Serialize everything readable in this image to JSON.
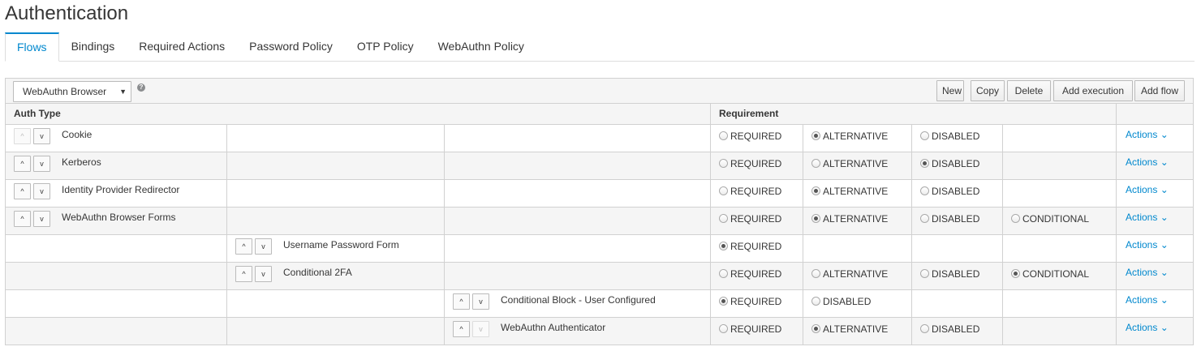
{
  "page": {
    "title": "Authentication"
  },
  "tabs": [
    {
      "label": "Flows",
      "active": true
    },
    {
      "label": "Bindings"
    },
    {
      "label": "Required Actions"
    },
    {
      "label": "Password Policy"
    },
    {
      "label": "OTP Policy"
    },
    {
      "label": "WebAuthn Policy"
    }
  ],
  "toolbar": {
    "flow_select": "WebAuthn Browser",
    "help_icon": "?",
    "buttons": {
      "new": "New",
      "copy": "Copy",
      "delete": "Delete",
      "add_execution": "Add execution",
      "add_flow": "Add flow"
    }
  },
  "table": {
    "headers": {
      "auth_type": "Auth Type",
      "requirement": "Requirement"
    },
    "rows": [
      {
        "level": 0,
        "name": "Cookie",
        "up_disabled": true,
        "down_disabled": false,
        "options": [
          {
            "label": "REQUIRED",
            "checked": false
          },
          {
            "label": "ALTERNATIVE",
            "checked": true
          },
          {
            "label": "DISABLED",
            "checked": false
          }
        ],
        "actions": "Actions"
      },
      {
        "level": 0,
        "name": "Kerberos",
        "up_disabled": false,
        "down_disabled": false,
        "options": [
          {
            "label": "REQUIRED",
            "checked": false
          },
          {
            "label": "ALTERNATIVE",
            "checked": false
          },
          {
            "label": "DISABLED",
            "checked": true
          }
        ],
        "actions": "Actions"
      },
      {
        "level": 0,
        "name": "Identity Provider Redirector",
        "up_disabled": false,
        "down_disabled": false,
        "options": [
          {
            "label": "REQUIRED",
            "checked": false
          },
          {
            "label": "ALTERNATIVE",
            "checked": true
          },
          {
            "label": "DISABLED",
            "checked": false
          }
        ],
        "actions": "Actions"
      },
      {
        "level": 0,
        "name": "WebAuthn Browser Forms",
        "up_disabled": false,
        "down_disabled": false,
        "options": [
          {
            "label": "REQUIRED",
            "checked": false
          },
          {
            "label": "ALTERNATIVE",
            "checked": true
          },
          {
            "label": "DISABLED",
            "checked": false
          },
          {
            "label": "CONDITIONAL",
            "checked": false
          }
        ],
        "actions": "Actions"
      },
      {
        "level": 1,
        "name": "Username Password Form",
        "up_disabled": false,
        "down_disabled": false,
        "options": [
          {
            "label": "REQUIRED",
            "checked": true
          }
        ],
        "actions": "Actions"
      },
      {
        "level": 1,
        "name": "Conditional 2FA",
        "up_disabled": false,
        "down_disabled": false,
        "options": [
          {
            "label": "REQUIRED",
            "checked": false
          },
          {
            "label": "ALTERNATIVE",
            "checked": false
          },
          {
            "label": "DISABLED",
            "checked": false
          },
          {
            "label": "CONDITIONAL",
            "checked": true
          }
        ],
        "actions": "Actions"
      },
      {
        "level": 2,
        "name": "Conditional Block - User Configured",
        "up_disabled": false,
        "down_disabled": false,
        "options": [
          {
            "label": "REQUIRED",
            "checked": true
          },
          {
            "label": "DISABLED",
            "checked": false
          }
        ],
        "actions": "Actions"
      },
      {
        "level": 2,
        "name": "WebAuthn Authenticator",
        "up_disabled": false,
        "down_disabled": true,
        "options": [
          {
            "label": "REQUIRED",
            "checked": false
          },
          {
            "label": "ALTERNATIVE",
            "checked": true
          },
          {
            "label": "DISABLED",
            "checked": false
          }
        ],
        "actions": "Actions"
      }
    ]
  },
  "icons": {
    "up": "chevron-up-icon",
    "down": "chevron-down-icon",
    "caret": "caret-down-icon"
  },
  "colors": {
    "accent": "#0088ce",
    "border": "#d1d1d1",
    "stripe": "#f5f5f5"
  }
}
